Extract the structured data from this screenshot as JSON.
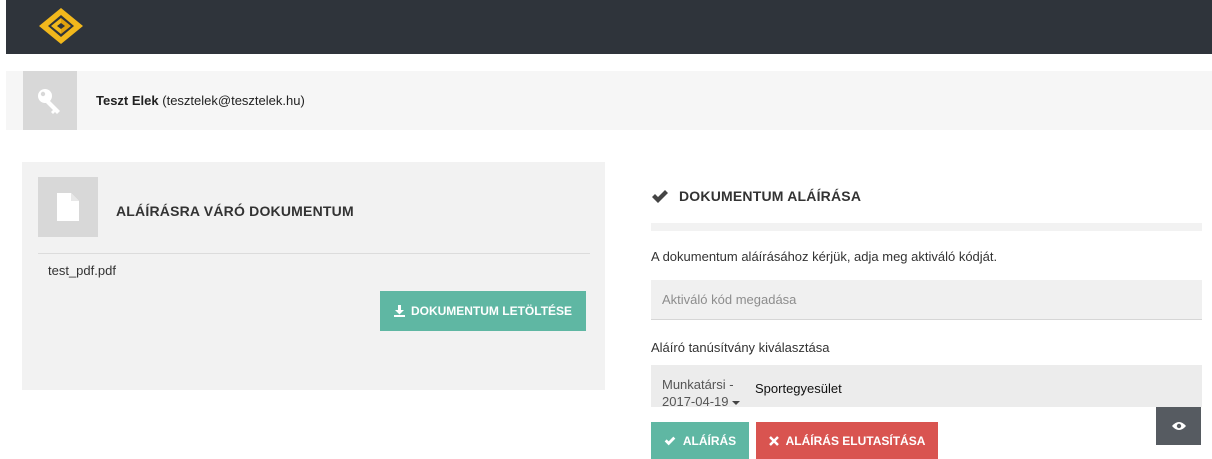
{
  "header": {
    "logo_icon": "diamond-logo-icon",
    "colors": {
      "background": "#2f343b",
      "logo_gold": "#f2b81c"
    }
  },
  "user": {
    "icon": "key-icon",
    "name": "Teszt Elek",
    "email": "(tesztelek@tesztelek.hu)"
  },
  "document_panel": {
    "icon": "file-icon",
    "title": "ALÁÍRÁSRA VÁRÓ DOKUMENTUM",
    "filename": "test_pdf.pdf",
    "download_icon": "download-icon",
    "download_label": "DOKUMENTUM LETÖLTÉSE"
  },
  "sign_panel": {
    "title_icon": "check-icon",
    "title": "DOKUMENTUM ALÁÍRÁSA",
    "instruction": "A dokumentum aláírásához kérjük, adja meg aktiváló kódját.",
    "code_input": {
      "value": "",
      "placeholder": "Aktiváló kód megadása"
    },
    "certificate_label": "Aláíró tanúsítvány kiválasztása",
    "certificate_select": {
      "type": "Munkatársi -",
      "date": "2017-04-19",
      "organization": "Sportegyesület"
    },
    "preview_icon": "eye-icon",
    "sign_icon": "check-icon",
    "sign_label": "ALÁÍRÁS",
    "reject_icon": "close-icon",
    "reject_label": "ALÁÍRÁS ELUTASÍTÁSA",
    "colors": {
      "primary": "#5fb7a3",
      "danger": "#d95450",
      "dark": "#565b61"
    }
  }
}
